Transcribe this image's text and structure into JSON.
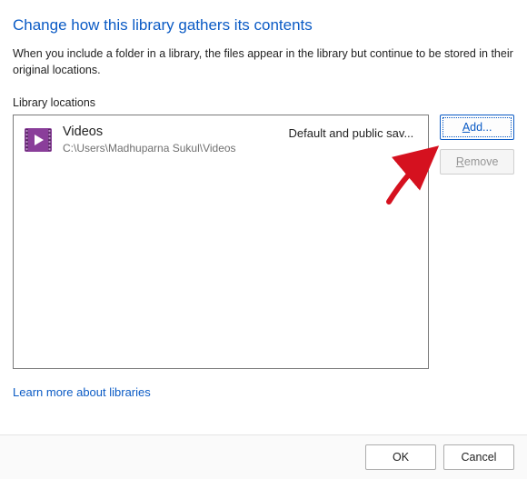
{
  "title": "Change how this library gathers its contents",
  "description": "When you include a folder in a library, the files appear in the library but continue to be stored in their original locations.",
  "section_label": "Library locations",
  "locations": [
    {
      "name": "Videos",
      "path": "C:\\Users\\Madhuparna Sukul\\Videos",
      "flag": "Default and public sav..."
    }
  ],
  "buttons": {
    "add": "Add...",
    "remove": "Remove"
  },
  "learn_link": "Learn more about libraries",
  "footer": {
    "ok": "OK",
    "cancel": "Cancel"
  }
}
